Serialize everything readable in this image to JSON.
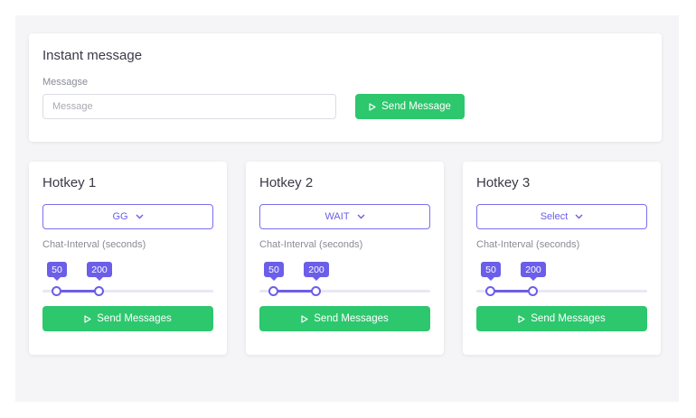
{
  "instant": {
    "title": "Instant message",
    "field_label": "Messagse",
    "placeholder": "Message",
    "value": "",
    "send_label": "Send Message"
  },
  "hotkeys": [
    {
      "title": "Hotkey 1",
      "selected": "GG",
      "interval_label": "Chat-Interval (seconds)",
      "min_value": "50",
      "max_value": "200",
      "min_frac": 0.08,
      "max_frac": 0.33,
      "send_label": "Send Messages"
    },
    {
      "title": "Hotkey 2",
      "selected": "WAIT",
      "interval_label": "Chat-Interval (seconds)",
      "min_value": "50",
      "max_value": "200",
      "min_frac": 0.08,
      "max_frac": 0.33,
      "send_label": "Send Messages"
    },
    {
      "title": "Hotkey 3",
      "selected": "Select",
      "interval_label": "Chat-Interval (seconds)",
      "min_value": "50",
      "max_value": "200",
      "min_frac": 0.08,
      "max_frac": 0.33,
      "send_label": "Send Messages"
    }
  ],
  "colors": {
    "accent": "#6b5ee8",
    "success": "#2dc76d",
    "background": "#f5f5f7"
  },
  "icons": {
    "send": "play-icon",
    "dropdown": "chevron-down-icon"
  }
}
